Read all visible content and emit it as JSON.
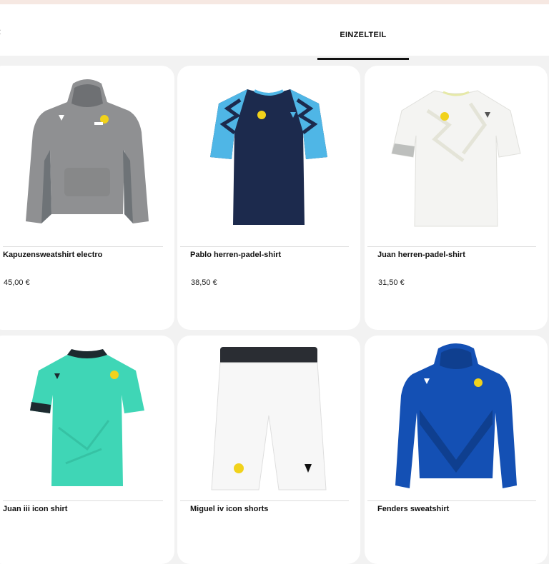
{
  "tabs": {
    "active_label": "EINZELTEIL"
  },
  "products": [
    {
      "name": "Kapuzensweatshirt electro",
      "price": "45,00 €",
      "icon": "grey-hoodie-icon"
    },
    {
      "name": "Pablo herren-padel-shirt",
      "price": "38,50 €",
      "icon": "navy-blue-tshirt-icon"
    },
    {
      "name": "Juan herren-padel-shirt",
      "price": "31,50 €",
      "icon": "white-tshirt-icon"
    },
    {
      "name": "Juan iii icon shirt",
      "price": "",
      "icon": "turquoise-tshirt-icon"
    },
    {
      "name": "Miguel iv icon shorts",
      "price": "",
      "icon": "white-shorts-icon"
    },
    {
      "name": "Fenders sweatshirt",
      "price": "",
      "icon": "blue-hoodie-icon"
    }
  ],
  "colors": {
    "accent": "#111111",
    "grey_hoodie": "#8f9092",
    "navy_shirt": "#1c2a4d",
    "light_blue": "#4fb6e6",
    "white_shirt": "#f4f4f2",
    "turquoise": "#3fd6b6",
    "royal_blue": "#1450b4"
  }
}
